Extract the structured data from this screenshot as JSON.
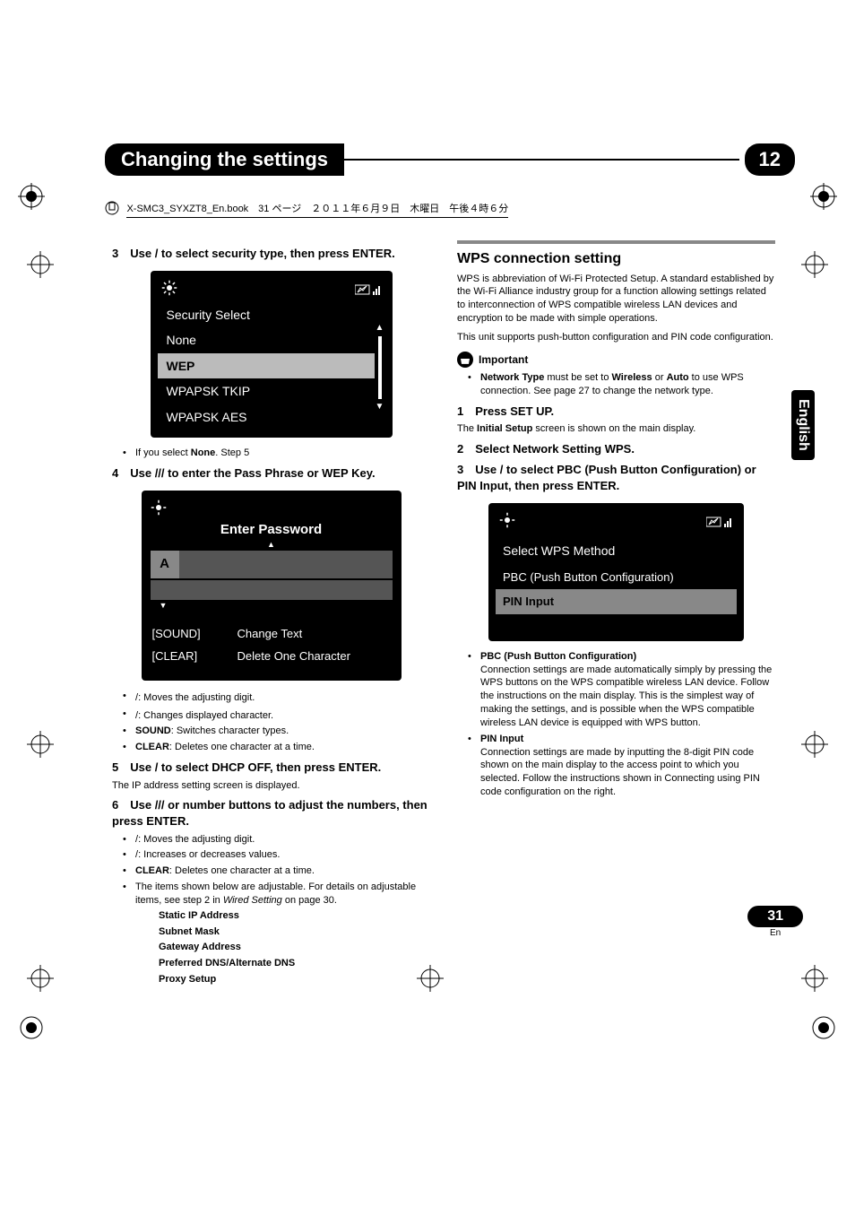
{
  "doc_label": "X-SMC3_SYXZT8_En.book　31 ページ　２０１１年６月９日　木曜日　午後４時６分",
  "chapter": {
    "title": "Changing the settings",
    "number": "12"
  },
  "language_tab": "English",
  "page_number": "31",
  "page_number_sub": "En",
  "left": {
    "step3": "3　Use / to select security type, then press ENTER.",
    "sec_box": {
      "title": "Security Select",
      "items": [
        "None",
        "WEP",
        "WPAPSK TKIP",
        "WPAPSK AES"
      ],
      "selected": "WEP"
    },
    "note_none": "If you select ",
    "note_none_bold": "None",
    "note_none_tail": ".  Step 5",
    "step4": "4　Use /// to enter the Pass Phrase or WEP Key.",
    "pw_box": {
      "title": "Enter Password",
      "letter": "A",
      "sound_label": "[SOUND]",
      "sound_text": "Change Text",
      "clear_label": "[CLEAR]",
      "clear_text": "Delete One Character"
    },
    "pw_bullets": [
      {
        "pre": "/",
        "text": ": Moves the adjusting digit."
      },
      {
        "pre": "/",
        "text": ": Changes displayed character."
      },
      {
        "bold": "SOUND",
        "text": ": Switches character types."
      },
      {
        "bold": "CLEAR",
        "text": ": Deletes one character at a time."
      }
    ],
    "step5": "5　Use / to select DHCP OFF, then press ENTER.",
    "step5_sub": "The IP address setting screen is displayed.",
    "step6": "6　Use /// or number buttons to adjust the numbers, then press ENTER.",
    "step6_bul": [
      {
        "pre": "/",
        "text": ": Moves the adjusting digit."
      },
      {
        "pre": "/",
        "text": ": Increases or decreases values."
      },
      {
        "bold": "CLEAR",
        "text": ": Deletes one character at a time."
      },
      {
        "text_a": "The items shown below are adjustable. For details on adjustable items, see step 2 in ",
        "ital": "Wired Setting",
        "text_b": " on page 30."
      }
    ],
    "adj_items": [
      "Static IP Address",
      "Subnet Mask",
      "Gateway Address",
      "Preferred DNS/Alternate DNS",
      "Proxy Setup"
    ]
  },
  "right": {
    "section_title": "WPS connection setting",
    "intro": "WPS is abbreviation of Wi-Fi Protected Setup. A standard established by the Wi-Fi Alliance industry group for a function allowing settings related to interconnection of WPS compatible wireless LAN devices and encryption to be made with simple operations.",
    "intro2": "This unit supports push-button configuration and PIN code configuration.",
    "important_label": "Important",
    "imp_bullet_a": "Network Type",
    "imp_bullet_b": " must be set to ",
    "imp_bullet_c": "Wireless",
    "imp_bullet_d": " or ",
    "imp_bullet_e": "Auto",
    "imp_bullet_f": " to use WPS connection. See page 27 to change the network type.",
    "step1": "1　Press SET UP.",
    "step1_sub_a": "The ",
    "step1_sub_b": "Initial Setup",
    "step1_sub_c": " screen is shown on the main display.",
    "step2": "2　Select Network Setting  WPS.",
    "step3": "3　Use / to select PBC (Push Button Configuration) or PIN Input, then press ENTER.",
    "wps_box": {
      "title": "Select WPS Method",
      "opt1": "PBC (Push Button Configuration)",
      "opt2": "PIN Input",
      "selected": "PIN Input"
    },
    "pbc_head": "PBC (Push Button Configuration)",
    "pbc_body": "Connection settings are made automatically simply by pressing the WPS buttons on the WPS compatible wireless LAN device. Follow the instructions on the main display. This is the simplest way of making the settings, and is possible when the WPS compatible wireless LAN device is equipped with WPS button.",
    "pin_head": "PIN Input",
    "pin_body": "Connection settings are made by inputting the 8-digit PIN code shown on the main display to the access point to which you selected. Follow the instructions shown in Connecting using PIN code configuration on the right."
  }
}
